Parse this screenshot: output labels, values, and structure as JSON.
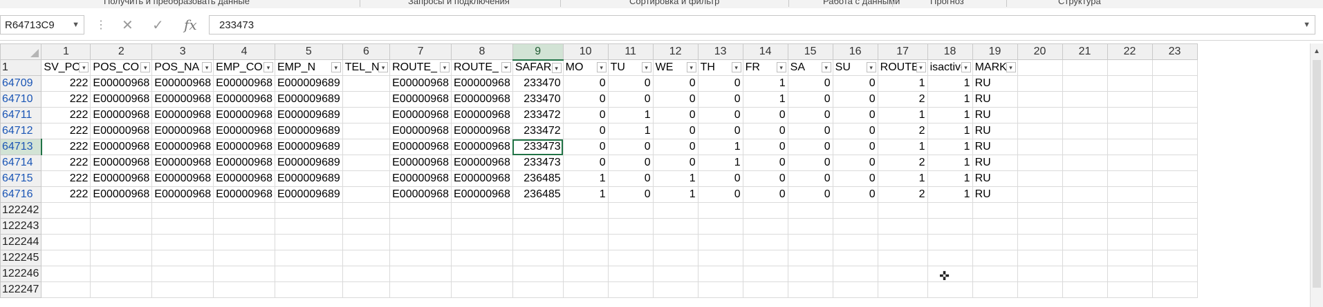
{
  "ribbon": {
    "groups": [
      "Получить и преобразовать данные",
      "Запросы и подключения",
      "Сортировка и фильтр",
      "Работа с данными",
      "Прогноз",
      "Структура"
    ]
  },
  "formula_bar": {
    "name_box": "R64713C9",
    "formula": "233473",
    "cancel_icon": "✕",
    "enter_icon": "✓",
    "fx_label": "fx"
  },
  "column_numbers": [
    "1",
    "2",
    "3",
    "4",
    "5",
    "6",
    "7",
    "8",
    "9",
    "10",
    "11",
    "12",
    "13",
    "14",
    "15",
    "16",
    "17",
    "18",
    "19",
    "20",
    "21",
    "22",
    "23"
  ],
  "row_numbers": [
    "1",
    "64709",
    "64710",
    "64711",
    "64712",
    "64713",
    "64714",
    "64715",
    "64716",
    "122242",
    "122243",
    "122244",
    "122245",
    "122246",
    "122247"
  ],
  "headers": [
    "SV_POS",
    "POS_CO",
    "POS_NA",
    "EMP_CO",
    "EMP_N",
    "TEL_NC",
    "ROUTE_",
    "ROUTE_",
    "SAFARI_",
    "MO",
    "TU",
    "WE",
    "TH",
    "FR",
    "SA",
    "SU",
    "ROUTE_",
    "isactive",
    "MARKE"
  ],
  "rows": [
    [
      "222",
      "E00000968",
      "E00000968",
      "E00000968",
      "E000009689",
      "",
      "E00000968",
      "E00000968",
      "233470",
      "0",
      "0",
      "0",
      "0",
      "1",
      "0",
      "0",
      "1",
      "1",
      "RU"
    ],
    [
      "222",
      "E00000968",
      "E00000968",
      "E00000968",
      "E000009689",
      "",
      "E00000968",
      "E00000968",
      "233470",
      "0",
      "0",
      "0",
      "0",
      "1",
      "0",
      "0",
      "2",
      "1",
      "RU"
    ],
    [
      "222",
      "E00000968",
      "E00000968",
      "E00000968",
      "E000009689",
      "",
      "E00000968",
      "E00000968",
      "233472",
      "0",
      "1",
      "0",
      "0",
      "0",
      "0",
      "0",
      "1",
      "1",
      "RU"
    ],
    [
      "222",
      "E00000968",
      "E00000968",
      "E00000968",
      "E000009689",
      "",
      "E00000968",
      "E00000968",
      "233472",
      "0",
      "1",
      "0",
      "0",
      "0",
      "0",
      "0",
      "2",
      "1",
      "RU"
    ],
    [
      "222",
      "E00000968",
      "E00000968",
      "E00000968",
      "E000009689",
      "",
      "E00000968",
      "E00000968",
      "233473",
      "0",
      "0",
      "0",
      "1",
      "0",
      "0",
      "0",
      "1",
      "1",
      "RU"
    ],
    [
      "222",
      "E00000968",
      "E00000968",
      "E00000968",
      "E000009689",
      "",
      "E00000968",
      "E00000968",
      "233473",
      "0",
      "0",
      "0",
      "1",
      "0",
      "0",
      "0",
      "2",
      "1",
      "RU"
    ],
    [
      "222",
      "E00000968",
      "E00000968",
      "E00000968",
      "E000009689",
      "",
      "E00000968",
      "E00000968",
      "236485",
      "1",
      "0",
      "1",
      "0",
      "0",
      "0",
      "0",
      "1",
      "1",
      "RU"
    ],
    [
      "222",
      "E00000968",
      "E00000968",
      "E00000968",
      "E000009689",
      "",
      "E00000968",
      "E00000968",
      "236485",
      "1",
      "0",
      "1",
      "0",
      "0",
      "0",
      "0",
      "2",
      "1",
      "RU"
    ]
  ],
  "colors": {
    "accent": "#217346",
    "row_link": "#1a55b5"
  }
}
